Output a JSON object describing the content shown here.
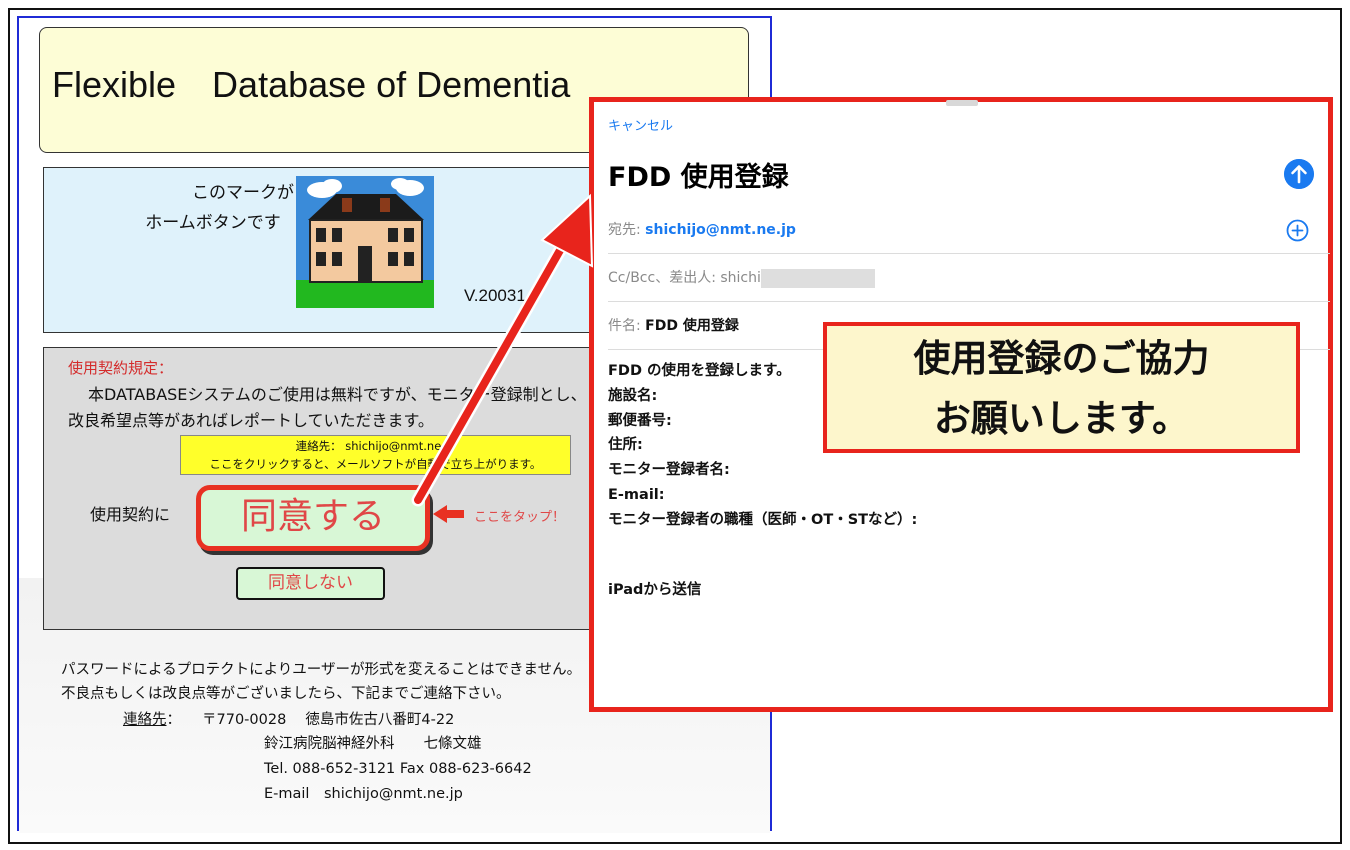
{
  "app_page": {
    "title": "Flexible　Database of Dementia",
    "home_label_line1": "このマークが",
    "home_label_line2": "ホームボタンです　→",
    "version": "V.20031",
    "contract": {
      "heading": "使用契約規定：",
      "body": "本DATABASEシステムのご使用は無料ですが、モニター登録制とし、改良希望点等があればレポートしていただきます。",
      "contact_line1": "連絡先： shichijo@nmt.ne.jp",
      "contact_line2": "ここをクリックすると、メールソフトが自動で立ち上がります。",
      "agree_prefix": "使用契約に",
      "agree_button": "同意する",
      "tap_note": "ここをタップ！",
      "disagree_button": "同意しない"
    },
    "footer": {
      "line1": "パスワードによるプロテクトによりユーザーが形式を変えることはできません。",
      "line2": "不良点もしくは改良点等がございましたら、下記までご連絡下さい。",
      "contact_label": "連絡先",
      "contact_colon": "：",
      "address": "〒770-0028　 徳島市佐古八番町4-22",
      "hospital": "鈴江病院脳神経外科　　七條文雄",
      "phone": "Tel.  088-652-3121  Fax  088-623-6642",
      "email": "E-mail　shichijo@nmt.ne.jp"
    }
  },
  "mail_compose": {
    "cancel": "キャンセル",
    "title": "FDD 使用登録",
    "to_label": "宛先: ",
    "to_value": "shichijo@nmt.ne.jp",
    "cc_label": "Cc/Bcc、差出人: ",
    "cc_value": "shichi",
    "subject_label": "件名: ",
    "subject_value": "FDD 使用登録",
    "body_lines": [
      "FDD の使用を登録します。",
      "施設名:",
      "郵便番号:",
      "住所:",
      "モニター登録者名:",
      "E-mail:",
      "モニター登録者の職種（医師・OT・STなど）:"
    ],
    "signature": "iPadから送信"
  },
  "callout": {
    "line1": "使用登録のご協力",
    "line2": "お願いします。"
  },
  "colors": {
    "highlight_red": "#e8241c",
    "ios_blue": "#1a7af0",
    "page_border_blue": "#1f2bd6",
    "title_yellow": "#fdfdd6",
    "home_box_blue": "#dff2fb",
    "contact_yellow": "#ffff2a",
    "button_green": "#d8f7d6"
  },
  "icons": {
    "home": "house-home-icon",
    "send": "arrow-up-circle-icon",
    "add": "plus-circle-icon"
  }
}
